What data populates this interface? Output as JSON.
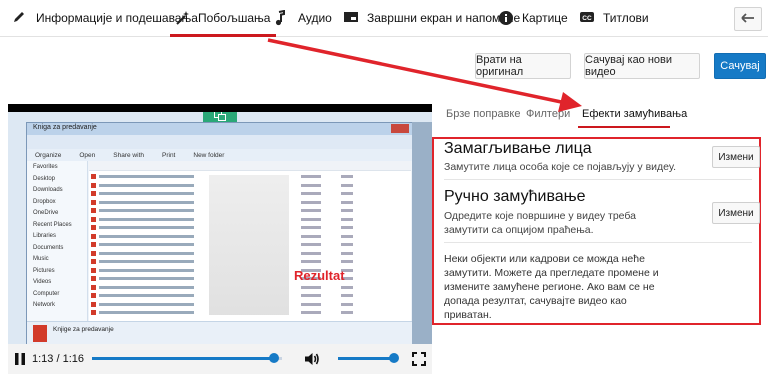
{
  "tabs": [
    {
      "label": "Информације и подешавања",
      "icon": "pencil-icon"
    },
    {
      "label": "Побољшања",
      "icon": "magic-wand-icon"
    },
    {
      "label": "Аудио",
      "icon": "music-note-icon"
    },
    {
      "label": "Завршни екран и напомене",
      "icon": "end-screen-icon"
    },
    {
      "label": "Картице",
      "icon": "info-circle-icon"
    },
    {
      "label": "Титлови",
      "icon": "cc-icon"
    }
  ],
  "actions": {
    "revert": "Врати на оригинал",
    "save_new": "Сачувај као нови видео",
    "save": "Сачувај"
  },
  "right_tabs": [
    "Брзе поправке",
    "Филтери",
    "Ефекти замућивања"
  ],
  "blur": {
    "face": {
      "title": "Замагљивање лица",
      "desc": "Замутите лица особа које се појављују у видеу.",
      "button": "Измени"
    },
    "custom": {
      "title": "Ручно замућивање",
      "desc": "Одредите које површине у видеу треба замутити са опцијом праћења.",
      "button": "Измени"
    },
    "note": "Неки објекти или кадрови се можда неће замутити. Можете да прегледате промене и измените замућене регионе. Ако вам се не допада резултат, сачувајте видео као приватан."
  },
  "player": {
    "time": "1:13 / 1:16",
    "progress": 0.96,
    "volume": 1.0
  },
  "video_frame": {
    "window_title": "Kniga za predavanje",
    "overlay_text": "Rezultat",
    "filename": "Knjige za predavanje",
    "nav_items": [
      "Favorites",
      "Desktop",
      "Downloads",
      "Dropbox",
      "OneDrive",
      "Recent Places",
      "Libraries",
      "Documents",
      "Music",
      "Pictures",
      "Videos",
      "Computer",
      "Network"
    ],
    "toolbar": [
      "Organize",
      "Open",
      "Share with",
      "Print",
      "New folder"
    ]
  },
  "colors": {
    "accent_red": "#cc181e",
    "annotation_red": "#e0242b",
    "primary_blue": "#167ac6"
  }
}
